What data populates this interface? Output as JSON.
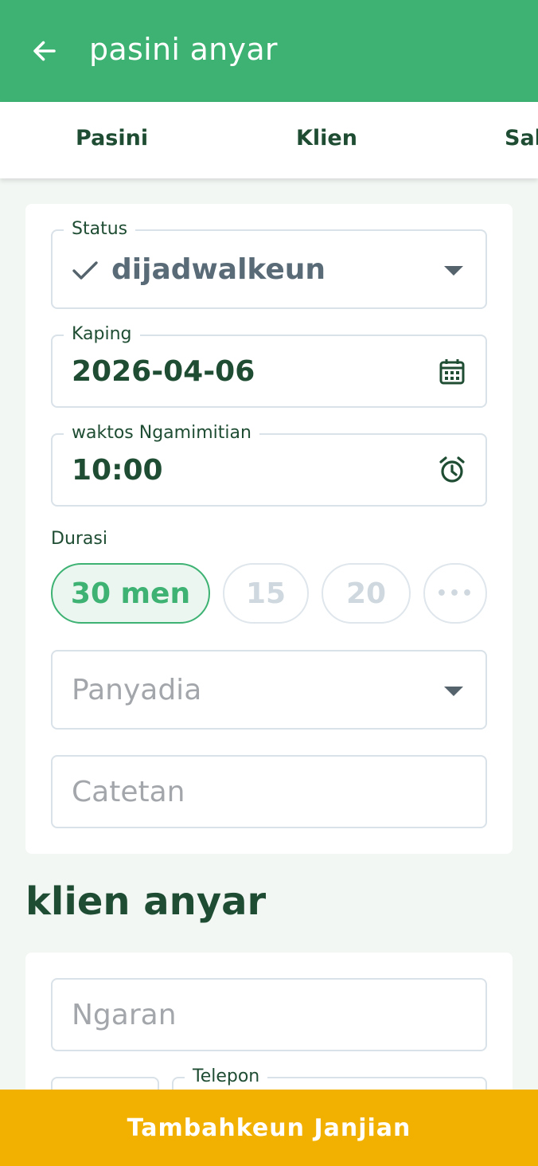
{
  "appbar": {
    "title": "pasini anyar",
    "back_icon": "arrow-left-icon"
  },
  "tabs": [
    {
      "label": "Pasini"
    },
    {
      "label": "Klien"
    },
    {
      "label": "Sab"
    }
  ],
  "appointment": {
    "status": {
      "label": "Status",
      "value": "dijadwalkeun",
      "icon": "check-icon"
    },
    "date": {
      "label": "Kaping",
      "value": "2026-04-06",
      "icon": "calendar-icon"
    },
    "start_time": {
      "label": "waktos Ngamimitian",
      "value": "10:00",
      "icon": "alarm-clock-icon"
    },
    "duration": {
      "label": "Durasi",
      "options": [
        {
          "label": "30 men",
          "selected": true
        },
        {
          "label": "15"
        },
        {
          "label": "20"
        },
        {
          "label": "•••"
        }
      ]
    },
    "provider": {
      "placeholder": "Panyadia"
    },
    "notes": {
      "placeholder": "Catetan"
    }
  },
  "new_client": {
    "title": "klien anyar",
    "name": {
      "placeholder": "Ngaran"
    },
    "phone": {
      "label": "Telepon"
    }
  },
  "submit": {
    "label": "Tambahkeun Janjian"
  },
  "colors": {
    "primary": "#3db273",
    "accent": "#f2b100",
    "text": "#1f4d33"
  }
}
